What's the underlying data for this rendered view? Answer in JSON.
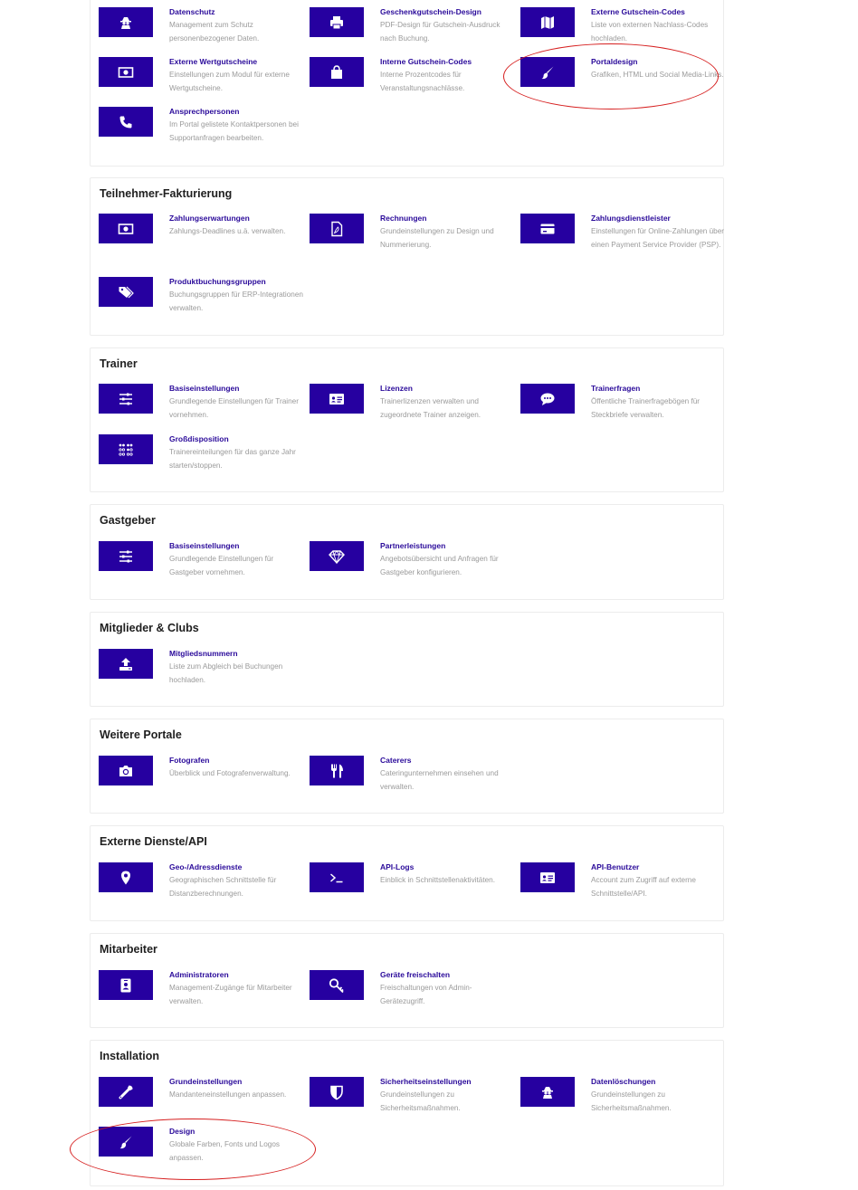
{
  "colors": {
    "accent": "#2600a0",
    "title": "#2a0a9a",
    "desc": "#9a9a9a",
    "highlight": "#d61f1f"
  },
  "sections": [
    {
      "title": "",
      "tiles": [
        {
          "title": "Datenschutz",
          "desc": "Management zum Schutz personenbezogener Daten.",
          "icon": "spy-icon"
        },
        {
          "title": "Geschenkgutschein-Design",
          "desc": "PDF-Design für Gutschein-Ausdruck nach Buchung.",
          "icon": "printer-icon"
        },
        {
          "title": "Externe Gutschein-Codes",
          "desc": "Liste von externen Nachlass-Codes hochladen.",
          "icon": "map-icon"
        },
        {
          "title": "Externe Wertgutscheine",
          "desc": "Einstellungen zum Modul für externe Wertgutscheine.",
          "icon": "money-icon"
        },
        {
          "title": "Interne Gutschein-Codes",
          "desc": "Interne Prozentcodes für Veranstaltungsnachlässe.",
          "icon": "shopping-bag-icon"
        },
        {
          "title": "Portaldesign",
          "desc": "Grafiken, HTML und Social Media-Links.",
          "icon": "paintbrush-icon"
        },
        {
          "title": "Ansprechpersonen",
          "desc": "Im Portal gelistete Kontaktpersonen bei Supportanfragen bearbeiten.",
          "icon": "phone-icon"
        }
      ]
    },
    {
      "title": "Teilnehmer-Fakturierung",
      "tiles": [
        {
          "title": "Zahlungserwartungen",
          "desc": "Zahlungs-Deadlines u.ä. verwalten.",
          "icon": "money-icon"
        },
        {
          "title": "Rechnungen",
          "desc": "Grundeinstellungen zu Design und Nummerierung.",
          "icon": "pdf-file-icon"
        },
        {
          "title": "Zahlungsdienstleister",
          "desc": "Einstellungen für Online-Zahlungen über einen Payment Service Provider (PSP).",
          "icon": "credit-card-icon"
        },
        {
          "title": "Produktbuchungsgruppen",
          "desc": "Buchungsgruppen für ERP-Integrationen verwalten.",
          "icon": "tags-icon"
        }
      ]
    },
    {
      "title": "Trainer",
      "tiles": [
        {
          "title": "Basiseinstellungen",
          "desc": "Grundlegende Einstellungen für Trainer vornehmen.",
          "icon": "sliders-icon"
        },
        {
          "title": "Lizenzen",
          "desc": "Trainerlizenzen verwalten und zugeordnete Trainer anzeigen.",
          "icon": "id-card-icon"
        },
        {
          "title": "Trainerfragen",
          "desc": "Öffentliche Trainerfragebögen für Steckbriefe verwalten.",
          "icon": "comment-icon"
        },
        {
          "title": "Großdisposition",
          "desc": "Trainereinteilungen für das ganze Jahr starten/stoppen.",
          "icon": "braille-icon"
        }
      ]
    },
    {
      "title": "Gastgeber",
      "tiles": [
        {
          "title": "Basiseinstellungen",
          "desc": "Grundlegende Einstellungen für Gastgeber vornehmen.",
          "icon": "sliders-icon"
        },
        {
          "title": "Partnerleistungen",
          "desc": "Angebotsübersicht und Anfragen für Gastgeber konfigurieren.",
          "icon": "diamond-icon"
        }
      ]
    },
    {
      "title": "Mitglieder & Clubs",
      "tiles": [
        {
          "title": "Mitgliedsnummern",
          "desc": "Liste zum Abgleich bei Buchungen hochladen.",
          "icon": "upload-icon"
        }
      ]
    },
    {
      "title": "Weitere Portale",
      "tiles": [
        {
          "title": "Fotografen",
          "desc": "Überblick und Fotografenverwaltung.",
          "icon": "camera-icon"
        },
        {
          "title": "Caterers",
          "desc": "Cateringunternehmen einsehen und verwalten.",
          "icon": "utensils-icon"
        }
      ]
    },
    {
      "title": "Externe Dienste/API",
      "tiles": [
        {
          "title": "Geo-/Adressdienste",
          "desc": "Geographischen Schnittstelle für Distanzberechnungen.",
          "icon": "map-marker-icon"
        },
        {
          "title": "API-Logs",
          "desc": "Einblick in Schnittstellenaktivitäten.",
          "icon": "terminal-icon"
        },
        {
          "title": "API-Benutzer",
          "desc": "Account zum Zugriff auf externe Schnittstelle/API.",
          "icon": "id-card-icon"
        }
      ]
    },
    {
      "title": "Mitarbeiter",
      "tiles": [
        {
          "title": "Administratoren",
          "desc": "Management-Zugänge für Mitarbeiter verwalten.",
          "icon": "id-badge-icon"
        },
        {
          "title": "Geräte freischalten",
          "desc": "Freischaltungen von Admin-Gerätezugriff.",
          "icon": "key-icon"
        }
      ]
    },
    {
      "title": "Installation",
      "tiles": [
        {
          "title": "Grundeinstellungen",
          "desc": "Mandanteneinstellungen anpassen.",
          "icon": "wrench-icon"
        },
        {
          "title": "Sicherheitseinstellungen",
          "desc": "Grundeinstellungen zu Sicherheitsmaßnahmen.",
          "icon": "shield-icon"
        },
        {
          "title": "Datenlöschungen",
          "desc": "Grundeinstellungen zu Sicherheitsmaßnahmen.",
          "icon": "spy-icon"
        },
        {
          "title": "Design",
          "desc": "Globale Farben, Fonts und Logos anpassen.",
          "icon": "paintbrush-icon"
        }
      ]
    }
  ]
}
